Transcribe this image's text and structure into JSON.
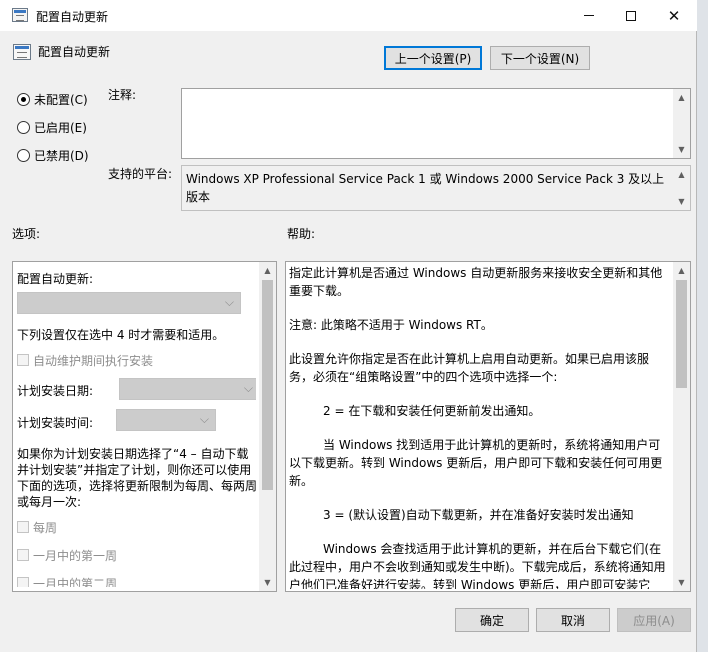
{
  "window": {
    "title": "配置自动更新",
    "minimize": "minimize",
    "maximize": "maximize",
    "close": "✕"
  },
  "header": {
    "policy_name": "配置自动更新",
    "prev_label": "上一个设置(P)",
    "next_label": "下一个设置(N)"
  },
  "state": {
    "options": [
      {
        "label": "未配置(C)",
        "selected": true
      },
      {
        "label": "已启用(E)",
        "selected": false
      },
      {
        "label": "已禁用(D)",
        "selected": false
      }
    ]
  },
  "comment": {
    "label": "注释:",
    "value": ""
  },
  "platform": {
    "label": "支持的平台:",
    "value": "Windows XP Professional Service Pack 1 或 Windows 2000 Service Pack 3 及以上版本"
  },
  "options_panel": {
    "label": "选项:",
    "configure_label": "配置自动更新:",
    "configure_value": "",
    "note": "下列设置仅在选中 4 时才需要和适用。",
    "maintenance_checkbox": "自动维护期间执行安装",
    "schedule_day_label": "计划安装日期:",
    "schedule_day_value": "",
    "schedule_time_label": "计划安装时间:",
    "schedule_time_value": "",
    "para_lines": [
      "如果你为计划安装日期选择了“4 – 自动下载",
      "并计划安装”并指定了计划，则你还可以使用",
      "下面的选项，选择将更新限制为每周、每两周",
      "或每月一次:"
    ],
    "weekly_checkbox": "每周",
    "first_week_checkbox": "一月中的第一周",
    "second_week_checkbox": "一月中的第二周"
  },
  "help": {
    "label": "帮助:",
    "p1": "指定此计算机是否通过 Windows 自动更新服务来接收安全更新和其他重要下载。",
    "p2": "注意: 此策略不适用于 Windows RT。",
    "p3": "此设置允许你指定是否在此计算机上启用自动更新。如果已启用该服务，必须在“组策略设置”中的四个选项中选择一个:",
    "p4": "2 = 在下载和安装任何更新前发出通知。",
    "p5": "当 Windows 找到适用于此计算机的更新时，系统将通知用户可以下载更新。转到 Windows 更新后，用户即可下载和安装任何可用更新。",
    "p6": "3 = (默认设置)自动下载更新，并在准备好安装时发出通知",
    "p7": "Windows 会查找适用于此计算机的更新，并在后台下载它们(在此过程中，用户不会收到通知或发生中断)。下载完成后，系统将通知用户他们已准备好进行安装。转到 Windows 更新后，用户即可安装它们。"
  },
  "footer": {
    "ok_label": "确定",
    "cancel_label": "取消",
    "apply_label": "应用(A)"
  },
  "colors": {
    "dialog_bg": "#f0f0f0",
    "focus_border": "#0078d7",
    "disabled_text": "#8d8d8d"
  }
}
